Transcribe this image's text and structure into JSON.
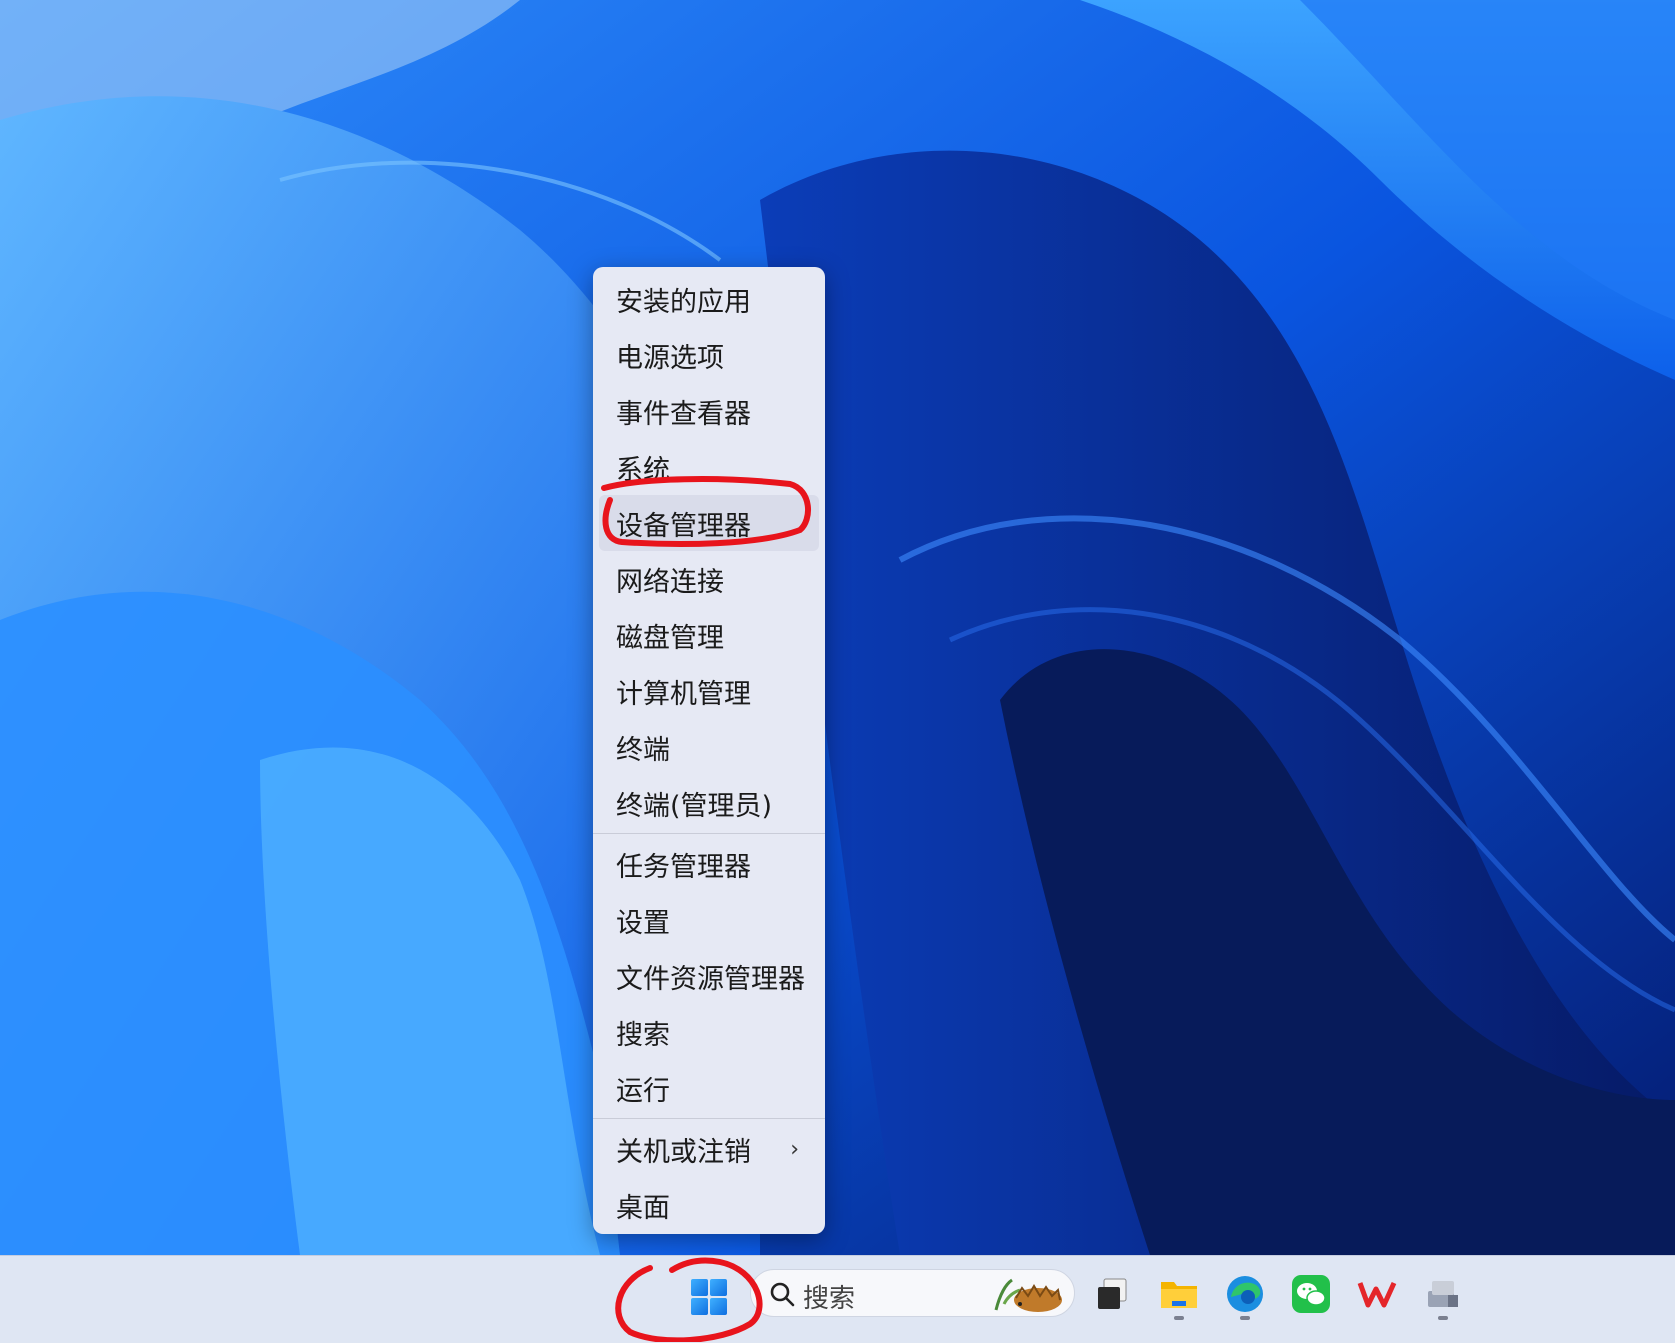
{
  "menu": {
    "items": [
      {
        "label": "安装的应用"
      },
      {
        "label": "电源选项"
      },
      {
        "label": "事件查看器"
      },
      {
        "label": "系统"
      },
      {
        "label": "设备管理器"
      },
      {
        "label": "网络连接"
      },
      {
        "label": "磁盘管理"
      },
      {
        "label": "计算机管理"
      },
      {
        "label": "终端"
      },
      {
        "label": "终端(管理员)"
      },
      {
        "label": "任务管理器"
      },
      {
        "label": "设置"
      },
      {
        "label": "文件资源管理器"
      },
      {
        "label": "搜索"
      },
      {
        "label": "运行"
      },
      {
        "label": "关机或注销"
      },
      {
        "label": "桌面"
      }
    ],
    "submenu_chevron": "›",
    "highlighted_item": "设备管理器"
  },
  "taskbar": {
    "search_placeholder": "搜索",
    "icons": [
      "windows-start-icon",
      "search-icon",
      "task-view-icon",
      "file-explorer-icon",
      "edge-icon",
      "wechat-icon",
      "wps-icon",
      "device-manager-icon"
    ]
  },
  "colors": {
    "annotation_red": "#e8141c",
    "menu_bg": "#e6e9f4",
    "taskbar_bg": "#dfe6f3"
  }
}
